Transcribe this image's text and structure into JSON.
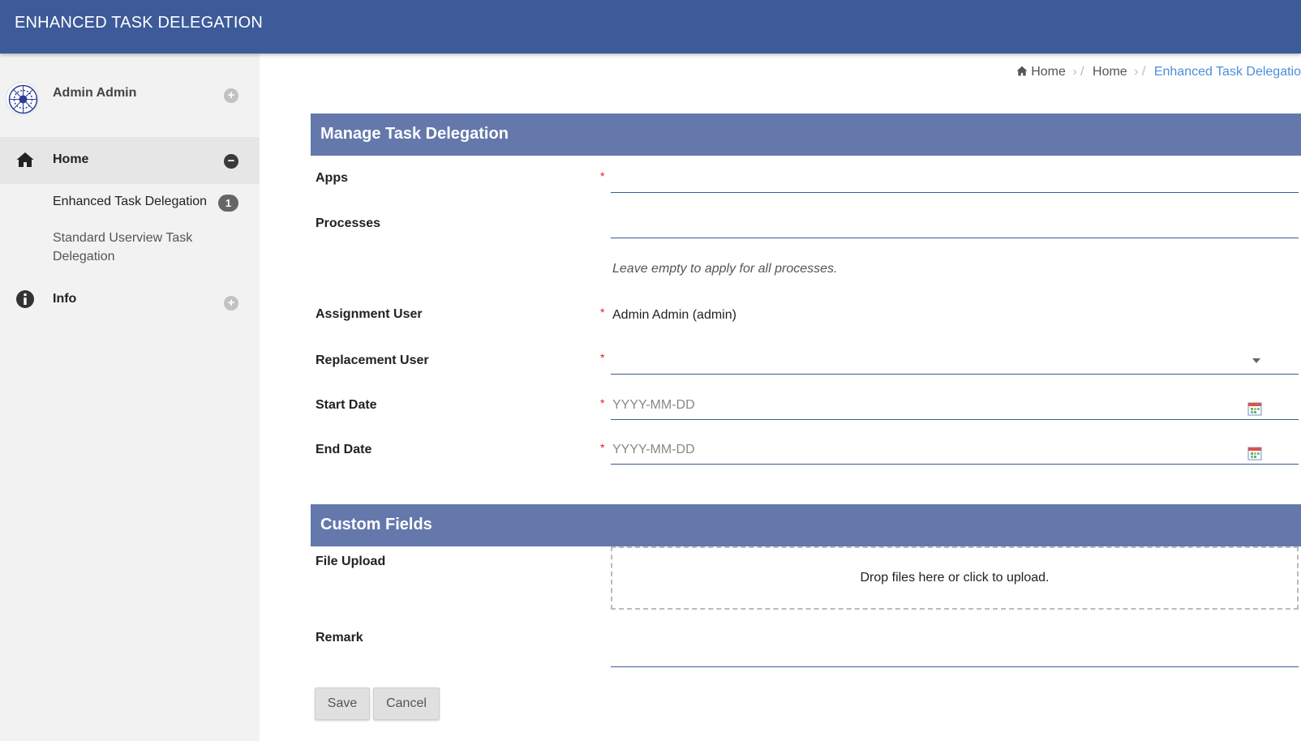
{
  "app": {
    "title": "ENHANCED TASK DELEGATION"
  },
  "sidebar": {
    "profile_name": "Admin Admin",
    "items": [
      {
        "label": "Home",
        "icon": "home-icon",
        "expanded": true
      },
      {
        "label": "Info",
        "icon": "info-icon",
        "expanded": false
      }
    ],
    "submenu": [
      {
        "label": "Enhanced Task Delegation",
        "badge": "1"
      },
      {
        "label": "Standard Userview Task Delegation"
      }
    ]
  },
  "breadcrumb": [
    "Home",
    "Home",
    "Enhanced Task Delegatio"
  ],
  "form": {
    "section_title": "Manage Task Delegation",
    "fields": {
      "apps": {
        "label": "Apps",
        "value": ""
      },
      "processes": {
        "label": "Processes",
        "value": "",
        "hint": "Leave empty to apply for all processes."
      },
      "assignment_user": {
        "label": "Assignment User",
        "value": "Admin Admin (admin)"
      },
      "replacement_user": {
        "label": "Replacement User",
        "value": ""
      },
      "start_date": {
        "label": "Start Date",
        "placeholder": "YYYY-MM-DD"
      },
      "end_date": {
        "label": "End Date",
        "placeholder": "YYYY-MM-DD"
      }
    },
    "required_mark": "*",
    "custom_section_title": "Custom Fields",
    "file_upload": {
      "label": "File Upload",
      "dropzone_text": "Drop files here or click to upload."
    },
    "remark": {
      "label": "Remark",
      "value": ""
    },
    "buttons": {
      "save": "Save",
      "cancel": "Cancel"
    }
  },
  "colors": {
    "header": "#3d5a99",
    "section": "#6478ac",
    "required": "#e02020",
    "breadcrumb_active": "#4a90d9"
  }
}
